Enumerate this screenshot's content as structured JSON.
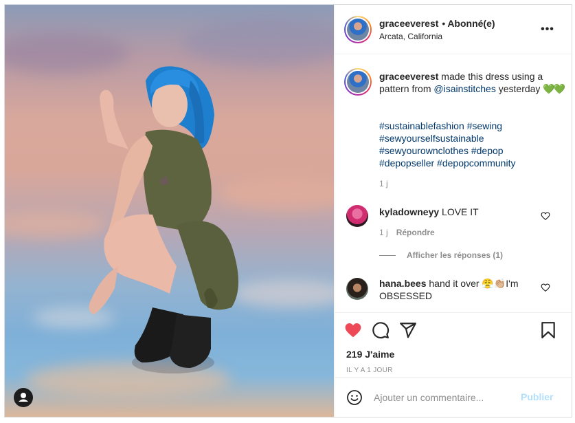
{
  "post": {
    "username": "graceeverest",
    "follow_status": "Abonné(e)",
    "dot": "•",
    "location": "Arcata, California",
    "more_label": "•••"
  },
  "caption": {
    "username": "graceeverest",
    "text_1": " made this dress using a pattern from ",
    "mention": "@isainstitches",
    "text_2": " yesterday ",
    "emoji": "💚💚",
    "hashtag_lines": [
      "#sustainablefashion #sewing",
      "#sewyourselfsustainable",
      "#sewyourownclothes #depop",
      "#depopseller #depopcommunity"
    ],
    "time": "1 j"
  },
  "comments": [
    {
      "username": "kyladowneyy",
      "text": " LOVE IT",
      "time": "1 j",
      "reply_label": "Répondre",
      "view_replies": "Afficher les réponses (1)"
    },
    {
      "username": "hana.bees",
      "text_before": " hand it over ",
      "emoji": "😤👏🏼",
      "text_after": "I'm OBSESSED"
    }
  ],
  "actions": {
    "likes": "219 J'aime",
    "timestamp": "Il y a 1 jour",
    "like_color": "#ed4956"
  },
  "add_comment": {
    "placeholder": "Ajouter un commentaire...",
    "post_label": "Publier"
  }
}
